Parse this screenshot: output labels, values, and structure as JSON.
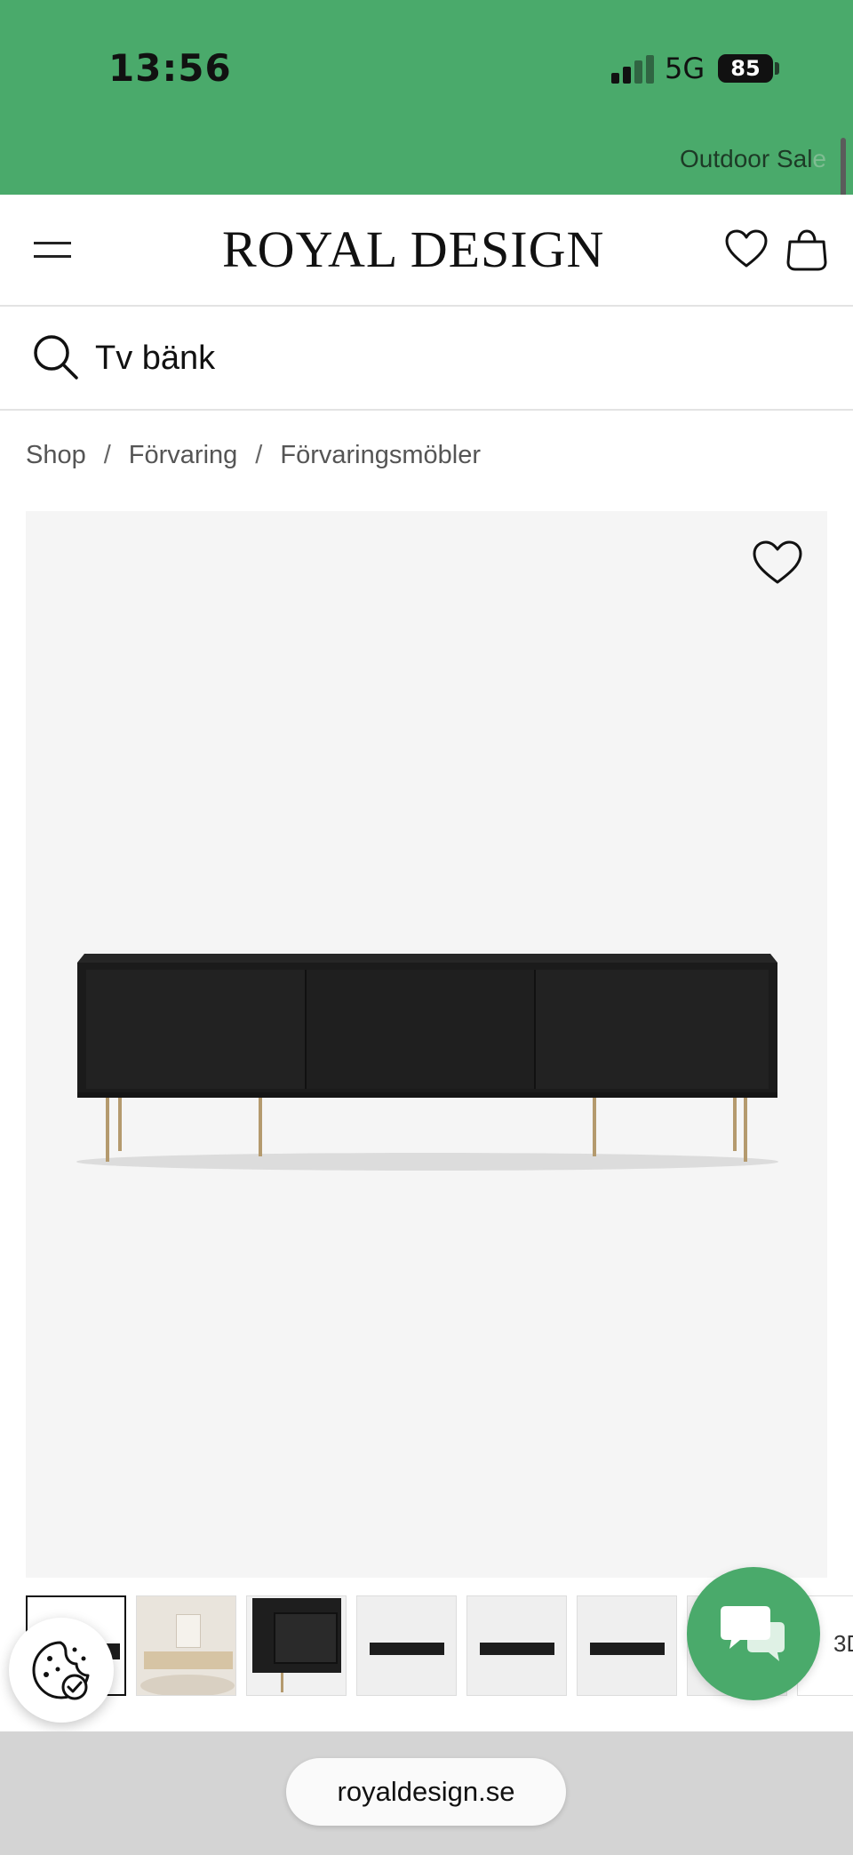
{
  "status_bar": {
    "time": "13:56",
    "network": "5G",
    "battery": "85",
    "background_color": "#4aaa6b"
  },
  "promo_banner": {
    "text": "Outdoor Sal",
    "faded_text": "e"
  },
  "header": {
    "logo": "ROYAL DESIGN",
    "menu_icon": "hamburger-menu-icon",
    "wishlist_icon": "heart-icon",
    "cart_icon": "shopping-bag-icon"
  },
  "search": {
    "value": "Tv bänk",
    "icon": "search-icon"
  },
  "breadcrumb": {
    "items": [
      "Shop",
      "Förvaring",
      "Förvaringsmöbler"
    ],
    "separator": "/"
  },
  "product_gallery": {
    "main_image": "black-tv-bench-sliding-doors-brass-legs",
    "favorite_icon": "heart-icon",
    "thumbnails": [
      "black-tv-bench-front",
      "beige-tv-bench-interior",
      "black-cabinet-open-detail",
      "black-tv-bench-wall-1",
      "black-tv-bench-wall-2",
      "black-tv-bench-wall-3",
      "black-tv-bench-wall-4",
      "3d-view"
    ],
    "thumbnail_partial_text": "3D"
  },
  "floating": {
    "cookie_icon": "cookie-settings-icon",
    "chat_icon": "chat-bubbles-icon",
    "accent_color": "#4aaa6b"
  },
  "browser": {
    "url": "royaldesign.se"
  }
}
